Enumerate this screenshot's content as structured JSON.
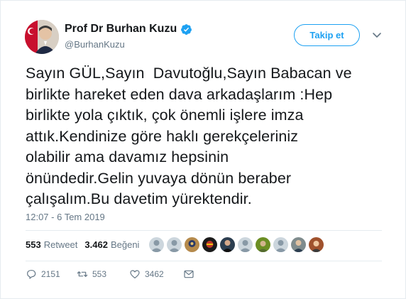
{
  "author": {
    "name": "Prof Dr Burhan Kuzu",
    "handle": "@BurhanKuzu",
    "verified": true
  },
  "follow_label": "Takip et",
  "tweet": {
    "text": "Sayın GÜL,Sayın  Davutoğlu,Sayın Babacan ve\nbirlikte hareket eden dava arkadaşlarım :Hep\nbirlikte yola çıktık, çok önemli işlere imza\nattık.Kendinize göre haklı gerekçeleriniz\nolabilir ama davamız hepsinin\nönündedir.Gelin yuvaya dönün beraber\nçalışalım.Bu davetim yürektendir.",
    "timestamp": "12:07 - 6 Tem 2019"
  },
  "stats": {
    "retweets_count": "553",
    "retweets_label": "Retweet",
    "likes_count": "3.462",
    "likes_label": "Beğeni"
  },
  "actions": {
    "replies": "2151",
    "retweets": "553",
    "likes": "3462"
  },
  "colors": {
    "accent": "#1da1f2",
    "muted": "#657786",
    "text": "#14171a",
    "border": "#e6ecf0"
  }
}
